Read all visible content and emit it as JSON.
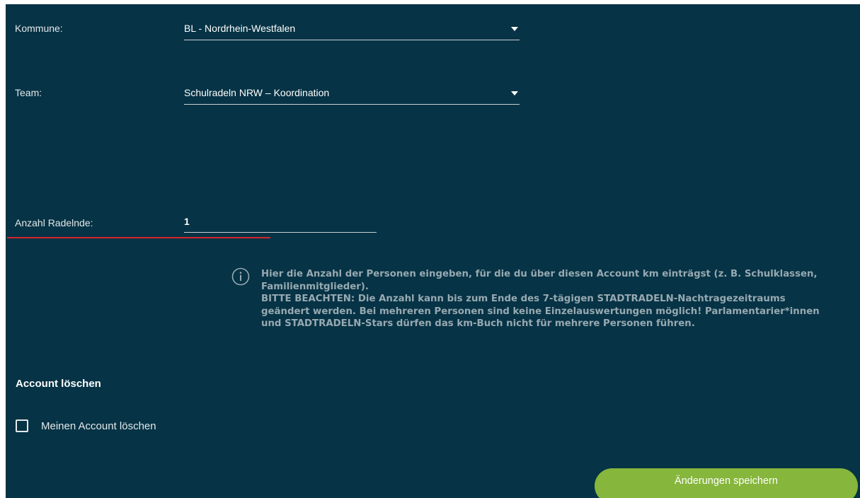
{
  "form": {
    "kommune": {
      "label": "Kommune:",
      "value": "BL - Nordrhein-Westfalen"
    },
    "team": {
      "label": "Team:",
      "value": "Schulradeln NRW – Koordination"
    },
    "riders": {
      "label": "Anzahl Radelnde:",
      "value": "1"
    },
    "info": {
      "lines": [
        "Hier die Anzahl der Personen eingeben, für die du über diesen Account km einträgst (z. B. Schulklassen,",
        "Familienmitglieder).",
        "BITTE BEACHTEN: Die Anzahl kann bis zum Ende des 7-tägigen STADTRADELN-Nachtragezeitraums",
        "geändert werden. Bei mehreren Personen sind keine Einzelauswertungen möglich! Parlamentarier*innen",
        "und STADTRADELN-Stars dürfen das km-Buch nicht für mehrere Personen führen."
      ]
    }
  },
  "account": {
    "section_title": "Account löschen",
    "delete_checkbox_label": "Meinen Account löschen",
    "delete_checked": false
  },
  "actions": {
    "save_label": "Änderungen speichern"
  },
  "colors": {
    "background": "#063345",
    "accent_green": "#86b63b",
    "error_red": "#d6242c",
    "info_text": "#97a9b1"
  }
}
